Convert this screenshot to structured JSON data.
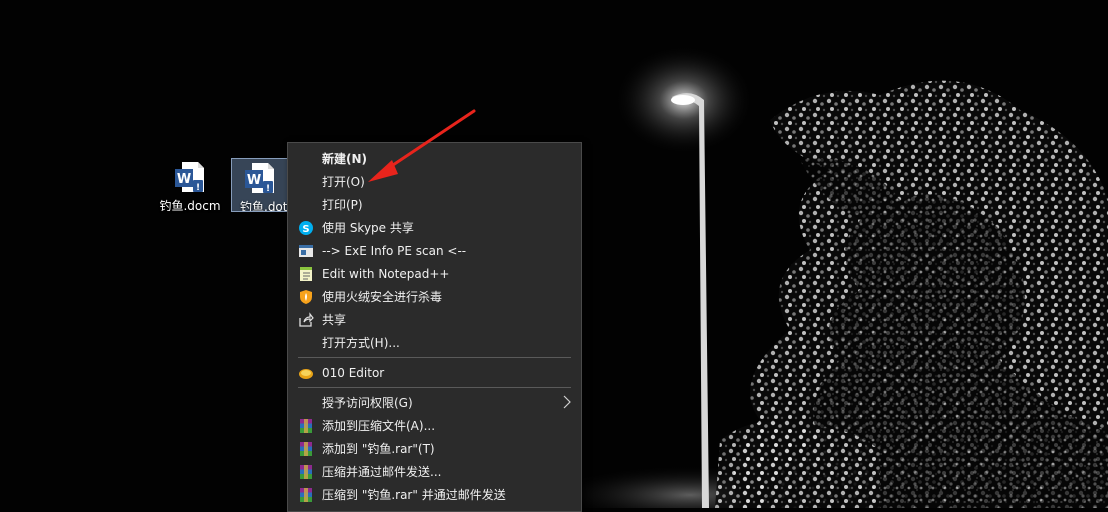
{
  "desktop": {
    "icons": [
      {
        "label": "钓鱼.docm",
        "selected": false
      },
      {
        "label": "钓鱼.dotm",
        "selected": true
      }
    ]
  },
  "context_menu": {
    "items": [
      {
        "label": "新建(N)",
        "bold": true,
        "icon": "none"
      },
      {
        "label": "打开(O)",
        "bold": false,
        "icon": "none"
      },
      {
        "label": "打印(P)",
        "bold": false,
        "icon": "none"
      },
      {
        "label": "使用 Skype 共享",
        "bold": false,
        "icon": "skype-icon"
      },
      {
        "label": "-->  ExE Info PE scan  <--",
        "bold": false,
        "icon": "exeinfo-icon"
      },
      {
        "label": "Edit with Notepad++",
        "bold": false,
        "icon": "notepadpp-icon"
      },
      {
        "label": "使用火绒安全进行杀毒",
        "bold": false,
        "icon": "huorong-shield-icon"
      },
      {
        "label": "共享",
        "bold": false,
        "icon": "share-icon"
      },
      {
        "label": "打开方式(H)...",
        "bold": false,
        "icon": "none"
      },
      {
        "label": "010 Editor",
        "bold": false,
        "icon": "010-editor-icon"
      },
      {
        "label": "授予访问权限(G)",
        "bold": false,
        "icon": "none",
        "submenu": true
      },
      {
        "label": "添加到压缩文件(A)...",
        "bold": false,
        "icon": "winrar-icon"
      },
      {
        "label": "添加到 \"钓鱼.rar\"(T)",
        "bold": false,
        "icon": "winrar-icon"
      },
      {
        "label": "压缩并通过邮件发送...",
        "bold": false,
        "icon": "winrar-icon"
      },
      {
        "label": "压缩到 \"钓鱼.rar\" 并通过邮件发送",
        "bold": false,
        "icon": "winrar-icon"
      }
    ]
  },
  "colors": {
    "menu_bg": "#2b2b2b",
    "annotation_arrow": "#e8241c",
    "word_blue": "#2b5797"
  }
}
